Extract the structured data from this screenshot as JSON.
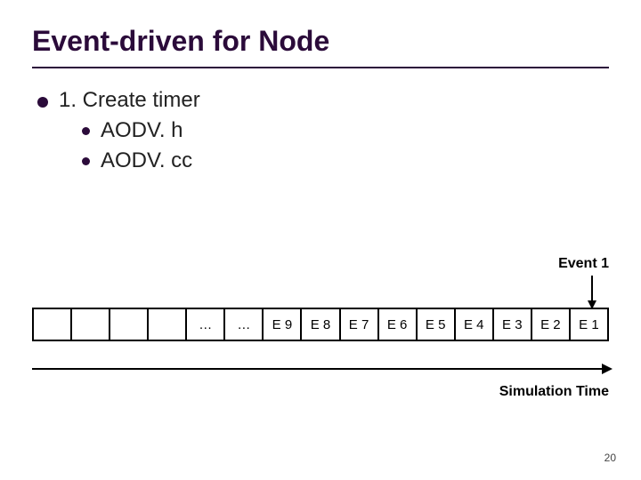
{
  "title": "Event-driven for Node",
  "bullets": {
    "l1": "1. Create timer",
    "l2a": "AODV. h",
    "l2b": "AODV. cc"
  },
  "event_label": "Event 1",
  "queue": [
    "",
    "",
    "",
    "",
    "…",
    "…",
    "E 9",
    "E 8",
    "E 7",
    "E 6",
    "E 5",
    "E 4",
    "E 3",
    "E 2",
    "E 1"
  ],
  "axis_label": "Simulation Time",
  "page_number": "20"
}
